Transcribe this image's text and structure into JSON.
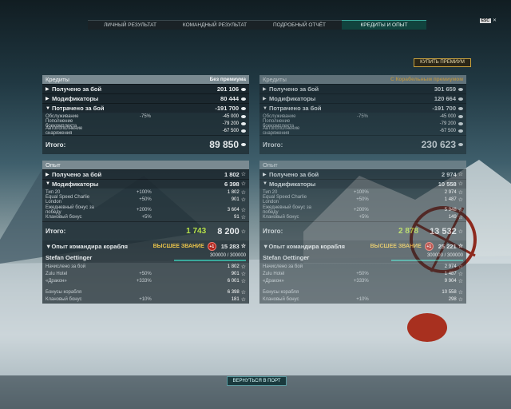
{
  "tabs": [
    "ЛИЧНЫЙ РЕЗУЛЬТАТ",
    "КОМАНДНЫЙ РЕЗУЛЬТАТ",
    "ПОДРОБНЫЙ ОТЧЁТ",
    "КРЕДИТЫ И ОПЫТ"
  ],
  "esc": "ESC",
  "premium_button": "КУПИТЬ ПРЕМИУМ",
  "return_button": "ВЕРНУТЬСЯ В ПОРТ",
  "left": {
    "credits_title": "Кредиты",
    "credits_mode": "Без премиума",
    "received": {
      "label": "Получено за бой",
      "value": "201 106"
    },
    "modifiers": {
      "label": "Модификаторы",
      "value": "80 444"
    },
    "spent": {
      "label": "Потрачено за бой",
      "value": "-191 700"
    },
    "costs": [
      {
        "label": "Обслуживание",
        "pct": "-75%",
        "value": "-45 000"
      },
      {
        "label": "Пополнение боекомплекта",
        "pct": "",
        "value": "-79 200"
      },
      {
        "label": "Автопополнение снаряжения",
        "pct": "",
        "value": "-67 500"
      }
    ],
    "total_label": "Итого:",
    "credits_total": "89 850",
    "xp_title": "Опыт",
    "xp_received": {
      "label": "Получено за бой",
      "value": "1 802"
    },
    "xp_modifiers": {
      "label": "Модификаторы",
      "value": "6 398"
    },
    "xp_mods": [
      {
        "label": "Тип 20",
        "pct": "+100%",
        "value": "1 802"
      },
      {
        "label": "Equal Speed Charlie London",
        "pct": "+50%",
        "value": "901"
      },
      {
        "label": "Ежедневный бонус за победу",
        "pct": "+200%",
        "value": "3 604"
      },
      {
        "label": "Клановый бонус",
        "pct": "+5%",
        "value": "91"
      }
    ],
    "xp_total_green": "1 743",
    "xp_total": "8 200",
    "cmdr_label": "Опыт командира корабля",
    "rank": "ВЫСШЕЕ ЗВАНИЕ",
    "rank_badge": "+1",
    "cmdr_value": "15 283",
    "cmdr_name": "Stefan Oettinger",
    "cmdr_progress": "300000 / 300000",
    "cmdr_fill": 1.0,
    "cmdr_rows": [
      {
        "label": "Начислено за бой",
        "pct": "",
        "value": "1 802"
      },
      {
        "label": "Zulu Hotel",
        "pct": "+50%",
        "value": "901"
      },
      {
        "label": "«Дракон»",
        "pct": "+333%",
        "value": "6 001"
      },
      {
        "label": "Бонусы корабля",
        "pct": "",
        "value": "6 398"
      },
      {
        "label": "Клановый бонус",
        "pct": "+10%",
        "value": "181"
      }
    ]
  },
  "right": {
    "credits_title": "Кредиты",
    "credits_mode": "С Корабельным премиумом",
    "received": {
      "label": "Получено за бой",
      "value": "301 659"
    },
    "modifiers": {
      "label": "Модификаторы",
      "value": "120 664"
    },
    "spent": {
      "label": "Потрачено за бой",
      "value": "-191 700"
    },
    "costs": [
      {
        "label": "Обслуживание",
        "pct": "-75%",
        "value": "-45 000"
      },
      {
        "label": "Пополнение боекомплекта",
        "pct": "",
        "value": "-79 200"
      },
      {
        "label": "Автопополнение снаряжения",
        "pct": "",
        "value": "-67 500"
      }
    ],
    "total_label": "Итого:",
    "credits_total": "230 623",
    "xp_title": "Опыт",
    "xp_received": {
      "label": "Получено за бой",
      "value": "2 974"
    },
    "xp_modifiers": {
      "label": "Модификаторы",
      "value": "10 558"
    },
    "xp_mods": [
      {
        "label": "Тип 20",
        "pct": "+100%",
        "value": "2 974"
      },
      {
        "label": "Equal Speed Charlie London",
        "pct": "+50%",
        "value": "1 487"
      },
      {
        "label": "Ежедневный бонус за победу",
        "pct": "+200%",
        "value": "5 948"
      },
      {
        "label": "Клановый бонус",
        "pct": "+5%",
        "value": "149"
      }
    ],
    "xp_total_green": "2 878",
    "xp_total": "13 532",
    "cmdr_label": "Опыт командира корабля",
    "rank": "ВЫСШЕЕ ЗВАНИЕ",
    "rank_badge": "+1",
    "cmdr_value": "25 221",
    "cmdr_name": "Stefan Oettinger",
    "cmdr_progress": "300000 / 300000",
    "cmdr_fill": 1.0,
    "cmdr_rows": [
      {
        "label": "Начислено за бой",
        "pct": "",
        "value": "2 974"
      },
      {
        "label": "Zulu Hotel",
        "pct": "+50%",
        "value": "1 487"
      },
      {
        "label": "«Дракон»",
        "pct": "+333%",
        "value": "9 904"
      },
      {
        "label": "Бонусы корабля",
        "pct": "",
        "value": "10 558"
      },
      {
        "label": "Клановый бонус",
        "pct": "+10%",
        "value": "298"
      }
    ]
  }
}
